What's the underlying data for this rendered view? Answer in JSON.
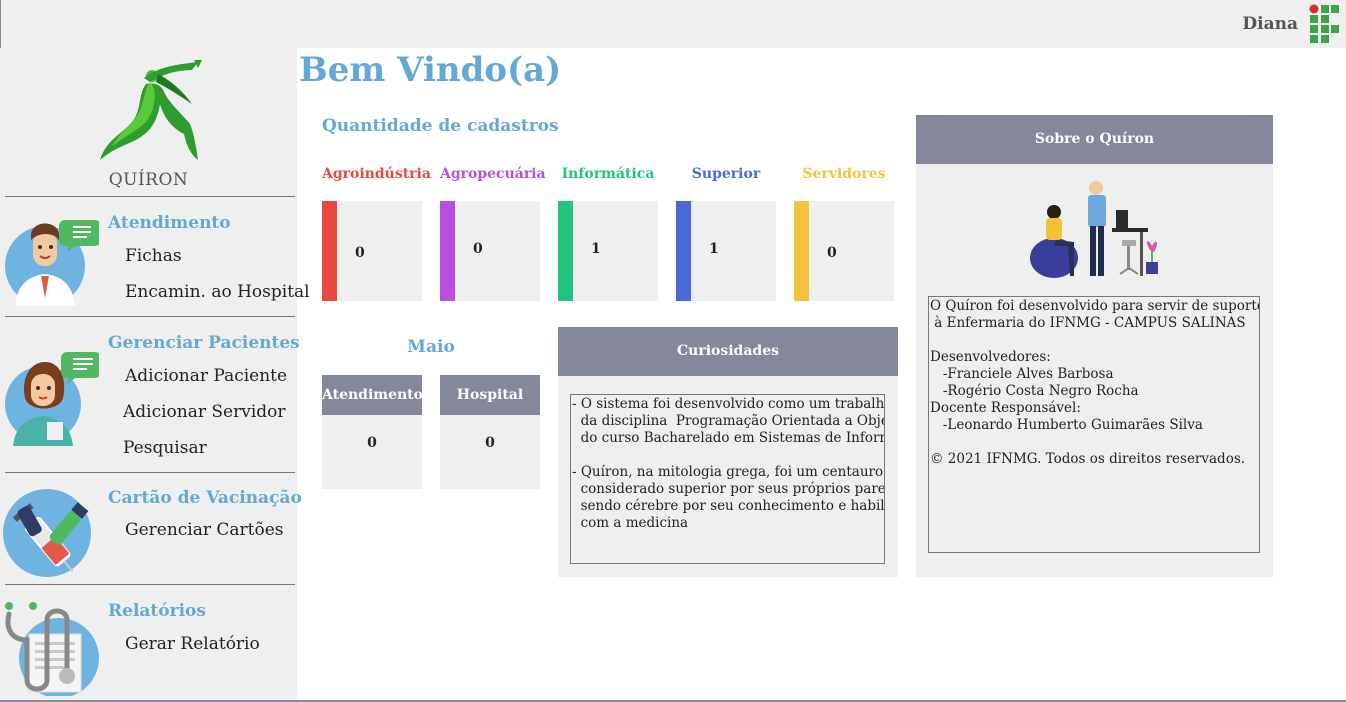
{
  "header": {
    "username": "Diana"
  },
  "sidebar": {
    "brand": "QUÍRON",
    "sections": [
      {
        "title": "Atendimento",
        "items": [
          "Fichas",
          "Encamin. ao Hospital"
        ]
      },
      {
        "title": "Gerenciar Pacientes",
        "items": [
          "Adicionar Paciente",
          "Adicionar Servidor",
          "Pesquisar"
        ]
      },
      {
        "title": "Cartão de Vacinação",
        "items": [
          "Gerenciar Cartões"
        ]
      },
      {
        "title": "Relatórios",
        "items": [
          "Gerar Relatório"
        ]
      }
    ]
  },
  "main": {
    "title": "Bem Vindo(a)",
    "registrations_title": "Quantidade de cadastros",
    "categories": [
      {
        "label": "Agroindústria",
        "value": "0",
        "color": "#e8493e"
      },
      {
        "label": "Agropecuária",
        "value": "0",
        "color": "#b94ee0"
      },
      {
        "label": "Informática",
        "value": "1",
        "color": "#22c47e"
      },
      {
        "label": "Superior",
        "value": "1",
        "color": "#4a69d9"
      },
      {
        "label": "Servidores",
        "value": "0",
        "color": "#f3c33e"
      }
    ],
    "month": {
      "name": "Maio",
      "stats": [
        {
          "label": "Atendimentos",
          "value": "0"
        },
        {
          "label": "Hospital",
          "value": "0"
        }
      ]
    },
    "curiosities": {
      "title": "Curiosidades",
      "text": "- O sistema foi desenvolvido como um trabalho\n  da disciplina  Programação Orientada a Objetos II,\n  do curso Bacharelado em Sistemas de Informação\n\n- Quíron, na mitologia grega, foi um centauro\n  considerado superior por seus próprios pares,\n  sendo cérebre por seu conhecimento e habilidade\n  com a medicina"
    },
    "about": {
      "title": "Sobre o Quíron",
      "text": "O Quíron foi desenvolvido para servir de suporte\n à Enfermaria do IFNMG - CAMPUS SALINAS\n\nDesenvolvedores:\n   -Franciele Alves Barbosa\n   -Rogério Costa Negro Rocha\nDocente Responsável:\n   -Leonardo Humberto Guimarães Silva\n\n© 2021 IFNMG. Todos os direitos reservados."
    }
  },
  "colors": {
    "accent": "#64a8d6",
    "panel_header": "#85889a",
    "panel_bg": "#efefef"
  }
}
